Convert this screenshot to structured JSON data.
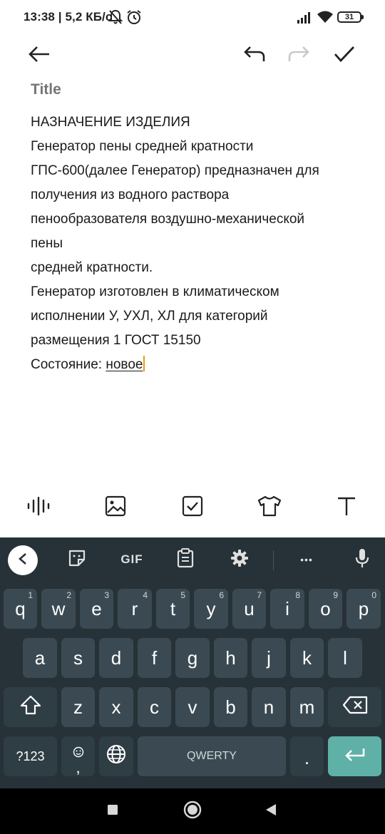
{
  "status_bar": {
    "time_speed": "13:38 | 5,2 КБ/с",
    "battery_level": "31"
  },
  "toolbar": {
    "back_icon": "arrow-left-icon",
    "undo_icon": "undo-icon",
    "redo_icon": "redo-icon",
    "done_icon": "check-icon"
  },
  "editor": {
    "title_placeholder": "Title",
    "lines": [
      "НАЗНАЧЕНИЕ ИЗДЕЛИЯ",
      "Генератор пены средней кратности",
      "ГПС-600(далее Генератор) предназначен для",
      "получения из водного раствора",
      "пенообразователя воздушно-механической",
      "пены",
      "средней кратности.",
      "Генератор изготовлен в климатическом",
      "исполнении У, УХЛ, ХЛ для категорий",
      "размещения 1 ГОСТ 15150"
    ],
    "last_line_prefix": "Состояние: ",
    "last_line_underlined": "новое"
  },
  "format_toolbar": [
    "voice-icon",
    "image-icon",
    "checkbox-icon",
    "shirt-icon",
    "text-format-icon"
  ],
  "keyboard": {
    "suggestion_icons": [
      "back-chevron-icon",
      "sticker-icon",
      "gif-icon",
      "clipboard-icon",
      "gear-icon",
      "more-icon",
      "mic-icon"
    ],
    "gif_label": "GIF",
    "more_label": "•••",
    "row1": [
      {
        "key": "q",
        "hint": "1"
      },
      {
        "key": "w",
        "hint": "2"
      },
      {
        "key": "e",
        "hint": "3"
      },
      {
        "key": "r",
        "hint": "4"
      },
      {
        "key": "t",
        "hint": "5"
      },
      {
        "key": "y",
        "hint": "6"
      },
      {
        "key": "u",
        "hint": "7"
      },
      {
        "key": "i",
        "hint": "8"
      },
      {
        "key": "o",
        "hint": "9"
      },
      {
        "key": "p",
        "hint": "0"
      }
    ],
    "row2": [
      "a",
      "s",
      "d",
      "f",
      "g",
      "h",
      "j",
      "k",
      "l"
    ],
    "row3": [
      "z",
      "x",
      "c",
      "v",
      "b",
      "n",
      "m"
    ],
    "symbols_label": "?123",
    "comma_label": ",",
    "space_label": "QWERTY",
    "period_label": "."
  },
  "colors": {
    "keyboard_bg": "#263238",
    "key_bg": "#3b4a52",
    "enter_bg": "#5fb0a6",
    "cursor": "#e8a000"
  }
}
